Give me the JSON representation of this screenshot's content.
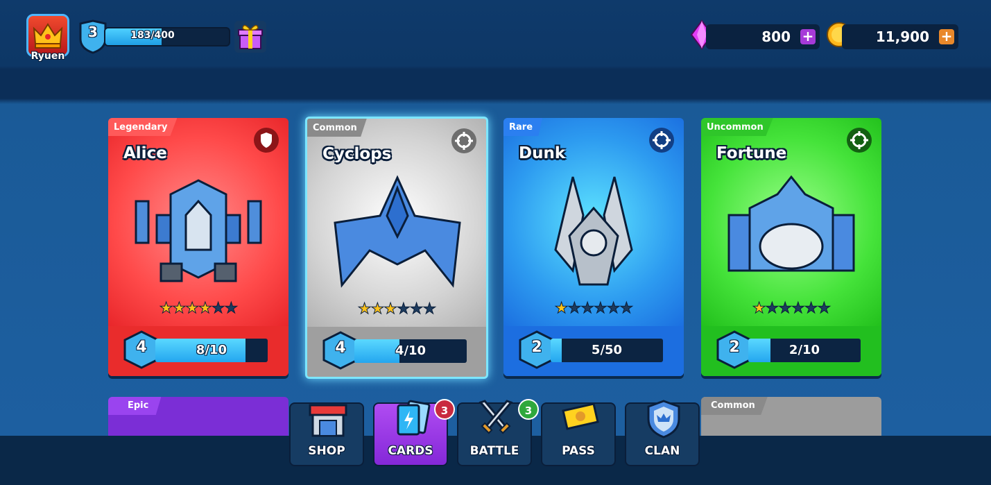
{
  "player": {
    "name": "Ryuen",
    "level": "3",
    "xp_text": "183/400",
    "xp_fraction": 0.4575
  },
  "currency": {
    "gems": {
      "value": "800",
      "icon": "gem-icon",
      "color": "#e23cf5"
    },
    "gold": {
      "value": "11,900",
      "icon": "gold-coin-icon",
      "color": "#ffb81c"
    }
  },
  "cards": [
    {
      "rarity": "Legendary",
      "name": "Alice",
      "stars": 4,
      "max_stars": 6,
      "level": "4",
      "progress": "8/10",
      "progress_fraction": 0.8,
      "role_icon": "shield-icon",
      "theme": "red"
    },
    {
      "rarity": "Common",
      "name": "Cyclops",
      "stars": 3,
      "max_stars": 6,
      "level": "4",
      "progress": "4/10",
      "progress_fraction": 0.4,
      "role_icon": "crosshair-icon",
      "theme": "gray"
    },
    {
      "rarity": "Rare",
      "name": "Dunk",
      "stars": 1,
      "max_stars": 6,
      "level": "2",
      "progress": "5/50",
      "progress_fraction": 0.1,
      "role_icon": "crosshair-icon",
      "theme": "blue"
    },
    {
      "rarity": "Uncommon",
      "name": "Fortune",
      "stars": 1,
      "max_stars": 6,
      "level": "2",
      "progress": "2/10",
      "progress_fraction": 0.2,
      "role_icon": "crosshair-icon",
      "theme": "green"
    }
  ],
  "next_row": [
    {
      "rarity": "Epic"
    },
    {
      "rarity": "Common"
    }
  ],
  "nav": [
    {
      "label": "SHOP",
      "icon": "shop-icon"
    },
    {
      "label": "CARDS",
      "icon": "cards-icon",
      "badge": "3",
      "active": true
    },
    {
      "label": "BATTLE",
      "icon": "crossed-swords-icon",
      "badge": "3"
    },
    {
      "label": "PASS",
      "icon": "ticket-icon"
    },
    {
      "label": "CLAN",
      "icon": "clan-shield-icon"
    }
  ]
}
